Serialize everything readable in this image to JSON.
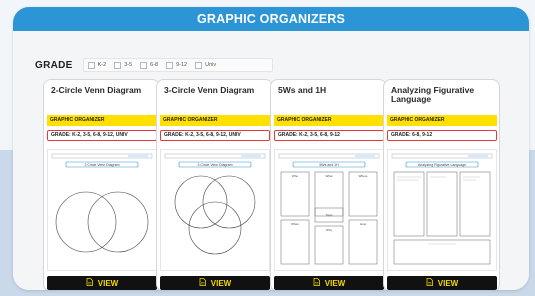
{
  "header": {
    "title": "GRAPHIC ORGANIZERS"
  },
  "filter": {
    "label": "GRADE",
    "options": [
      "K-2",
      "3-5",
      "6-8",
      "9-12",
      "Univ"
    ]
  },
  "cards": [
    {
      "title": "2-Circle Venn Diagram",
      "tag": "GRAPHIC ORGANIZER",
      "grades": "GRADE: K-2, 3-5, 6-8, 9-12, UNIV",
      "thumb_title": "2 Circle Venn Diagram",
      "button": "VIEW"
    },
    {
      "title": "3-Circle Venn Diagram",
      "tag": "GRAPHIC ORGANIZER",
      "grades": "GRADE: K-2, 3-5, 6-8, 9-12, UNIV",
      "thumb_title": "3 Circle Venn Diagram",
      "button": "VIEW"
    },
    {
      "title": "5Ws and 1H",
      "tag": "GRAPHIC ORGANIZER",
      "grades": "GRADE: K-2, 3-5, 6-8, 9-12",
      "thumb_title": "5Ws and 1H",
      "thumb_labels": [
        "Who",
        "What",
        "Where",
        "How",
        "When",
        "Why",
        "Topic"
      ],
      "button": "VIEW"
    },
    {
      "title": "Analyzing Figurative Language",
      "tag": "GRAPHIC ORGANIZER",
      "grades": "GRADE: 6-8, 9-12",
      "thumb_title": "Analyzing Figurative Language",
      "button": "VIEW"
    }
  ],
  "colors": {
    "header": "#2b95d6",
    "tag": "#ffe000",
    "grade_border": "#e23b3b",
    "button_bg": "#111111",
    "button_text": "#f6d800"
  }
}
